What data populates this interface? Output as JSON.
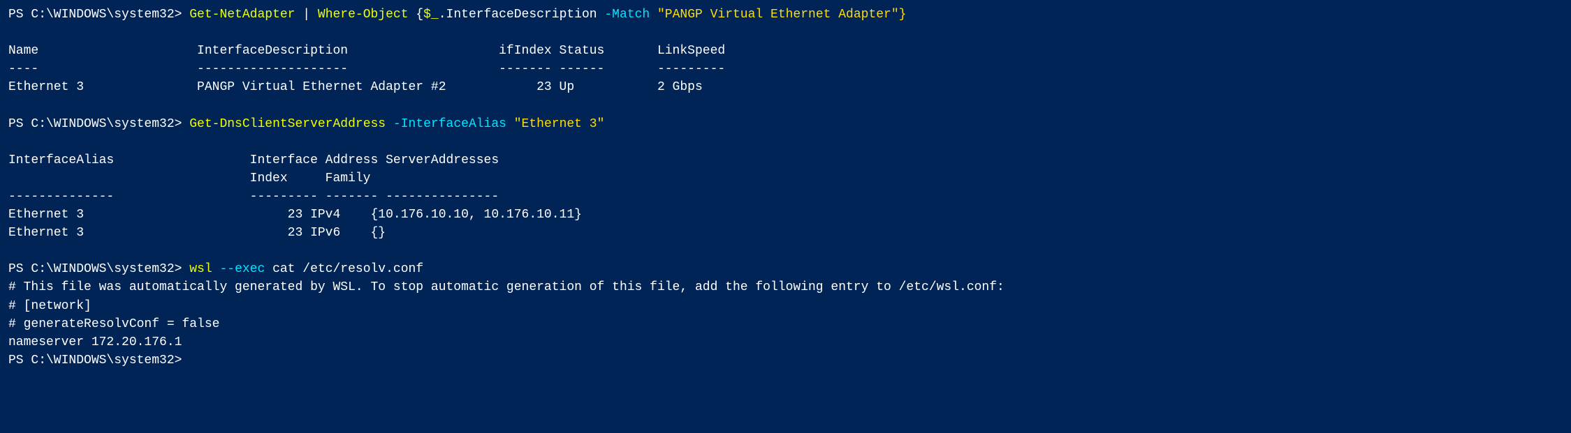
{
  "terminal": {
    "lines": [
      {
        "id": "cmd1",
        "type": "command",
        "parts": [
          {
            "text": "PS C:\\WINDOWS\\system32> ",
            "style": "prompt"
          },
          {
            "text": "Get-NetAdapter",
            "style": "cmd-yellow"
          },
          {
            "text": " | ",
            "style": "cmd-white"
          },
          {
            "text": "Where-Object",
            "style": "cmd-yellow"
          },
          {
            "text": " {",
            "style": "cmd-white"
          },
          {
            "text": "$_",
            "style": "cmd-yellow"
          },
          {
            "text": ".InterfaceDescription ",
            "style": "cmd-white"
          },
          {
            "text": "-Match",
            "style": "cmd-cyan"
          },
          {
            "text": " \"PANGP Virtual Ethernet Adapter\"}",
            "style": "cmd-string"
          }
        ]
      },
      {
        "id": "blank1",
        "type": "blank"
      },
      {
        "id": "header1",
        "type": "plain",
        "parts": [
          {
            "text": "Name                     InterfaceDescription                    ifIndex Status       LinkSpeed",
            "style": "header-white"
          }
        ]
      },
      {
        "id": "sep1",
        "type": "plain",
        "parts": [
          {
            "text": "----                     --------------------                    ------- ------       ---------",
            "style": "header-white"
          }
        ]
      },
      {
        "id": "row1",
        "type": "plain",
        "parts": [
          {
            "text": "Ethernet 3               PANGP Virtual Ethernet Adapter #2            23 Up           2 Gbps",
            "style": "value-white"
          }
        ]
      },
      {
        "id": "blank2",
        "type": "blank"
      },
      {
        "id": "cmd2",
        "type": "command",
        "parts": [
          {
            "text": "PS C:\\WINDOWS\\system32> ",
            "style": "prompt"
          },
          {
            "text": "Get-DnsClientServerAddress",
            "style": "cmd-yellow"
          },
          {
            "text": " ",
            "style": "cmd-white"
          },
          {
            "text": "-InterfaceAlias",
            "style": "cmd-cyan"
          },
          {
            "text": " \"Ethernet 3\"",
            "style": "cmd-string"
          }
        ]
      },
      {
        "id": "blank3",
        "type": "blank"
      },
      {
        "id": "header2a",
        "type": "plain",
        "parts": [
          {
            "text": "InterfaceAlias                  Interface Address ServerAddresses",
            "style": "header-white"
          }
        ]
      },
      {
        "id": "header2b",
        "type": "plain",
        "parts": [
          {
            "text": "                                Index     Family",
            "style": "header-white"
          }
        ]
      },
      {
        "id": "sep2",
        "type": "plain",
        "parts": [
          {
            "text": "--------------                  --------- ------- ---------------",
            "style": "header-white"
          }
        ]
      },
      {
        "id": "row2a",
        "type": "plain",
        "parts": [
          {
            "text": "Ethernet 3                           23 IPv4    {10.176.10.10, 10.176.10.11}",
            "style": "value-white"
          }
        ]
      },
      {
        "id": "row2b",
        "type": "plain",
        "parts": [
          {
            "text": "Ethernet 3                           23 IPv6    {}",
            "style": "value-white"
          }
        ]
      },
      {
        "id": "blank4",
        "type": "blank"
      },
      {
        "id": "cmd3",
        "type": "command",
        "parts": [
          {
            "text": "PS C:\\WINDOWS\\system32> ",
            "style": "prompt"
          },
          {
            "text": "wsl",
            "style": "cmd-yellow"
          },
          {
            "text": " ",
            "style": "cmd-white"
          },
          {
            "text": "--exec",
            "style": "cmd-cyan"
          },
          {
            "text": " cat /etc/resolv.conf",
            "style": "cmd-white"
          }
        ]
      },
      {
        "id": "comment1",
        "type": "plain",
        "parts": [
          {
            "text": "# This file was automatically generated by WSL. To stop automatic generation of this file, add the following entry to /etc/wsl.conf:",
            "style": "comment"
          }
        ]
      },
      {
        "id": "comment2",
        "type": "plain",
        "parts": [
          {
            "text": "# [network]",
            "style": "comment"
          }
        ]
      },
      {
        "id": "comment3",
        "type": "plain",
        "parts": [
          {
            "text": "# generateResolvConf = false",
            "style": "comment"
          }
        ]
      },
      {
        "id": "nameserver",
        "type": "plain",
        "parts": [
          {
            "text": "nameserver 172.20.176.1",
            "style": "value-white"
          }
        ]
      },
      {
        "id": "prompt_end",
        "type": "plain",
        "parts": [
          {
            "text": "PS C:\\WINDOWS\\system32> ",
            "style": "prompt"
          }
        ]
      }
    ]
  }
}
